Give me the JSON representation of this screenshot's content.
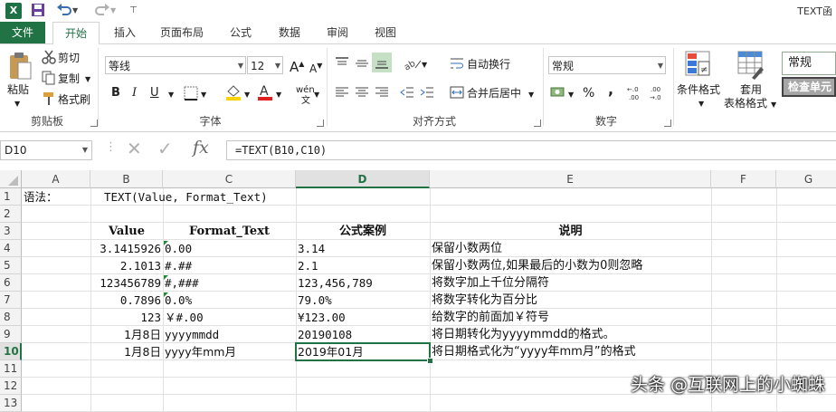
{
  "window": {
    "title": "TEXT函"
  },
  "tabs": [
    "文件",
    "开始",
    "插入",
    "页面布局",
    "公式",
    "数据",
    "审阅",
    "视图"
  ],
  "clipboard": {
    "paste": "粘贴",
    "cut": "剪切",
    "copy": "复制",
    "format_painter": "格式刷",
    "group_label": "剪贴板"
  },
  "font": {
    "name": "等线",
    "size": "12",
    "grow": "A",
    "shrink": "A",
    "bold": "B",
    "italic": "I",
    "underline": "U",
    "phonetic": "wén",
    "group_label": "字体"
  },
  "alignment": {
    "wrap": "自动换行",
    "merge": "合并后居中",
    "group_label": "对齐方式"
  },
  "number": {
    "format": "常规",
    "percent": "%",
    "comma": ",",
    "group_label": "数字"
  },
  "styles": {
    "conditional": "条件格式",
    "table_line1": "套用",
    "table_line2": "表格格式",
    "style_normal": "常规",
    "style_check": "检查单元"
  },
  "formula_bar": {
    "name_box": "D10",
    "fx": "fx",
    "formula": "=TEXT(B10,C10)"
  },
  "columns": [
    "A",
    "B",
    "C",
    "D",
    "E",
    "F",
    "G"
  ],
  "rows": [
    "1",
    "2",
    "3",
    "4",
    "5",
    "6",
    "7",
    "8",
    "9",
    "10",
    "11",
    "12",
    "13"
  ],
  "sheet": {
    "a1": "语法：",
    "b1": "TEXT(Value, Format_Text)",
    "headers": {
      "value": "Value",
      "format": "Format_Text",
      "example": "公式案例",
      "note": "说明"
    },
    "data": [
      {
        "value": "3.1415926",
        "format": "0.00",
        "result": "3.14",
        "note": "保留小数两位"
      },
      {
        "value": "2.1013",
        "format": "#.##",
        "result": "2.1",
        "note": "保留小数两位,如果最后的小数为0则忽略"
      },
      {
        "value": "123456789",
        "format": "#,###",
        "result": "123,456,789",
        "note": "将数字加上千位分隔符"
      },
      {
        "value": "0.7896",
        "format": "0.0%",
        "result": "79.0%",
        "note": "将数字转化为百分比"
      },
      {
        "value": "123",
        "format": "￥#.00",
        "result": "¥123.00",
        "note": "给数字的前面加￥符号"
      },
      {
        "value": "1月8日",
        "format": "yyyymmdd",
        "result": "20190108",
        "note": "将日期转化为yyyymmdd的格式。"
      },
      {
        "value": "1月8日",
        "format": "yyyy年mm月",
        "result": "2019年01月",
        "note": "将日期格式化为“yyyy年mm月”的格式"
      }
    ]
  },
  "watermark": "头条 @互联网上的小蜘蛛",
  "colors": {
    "accent": "#217346"
  }
}
